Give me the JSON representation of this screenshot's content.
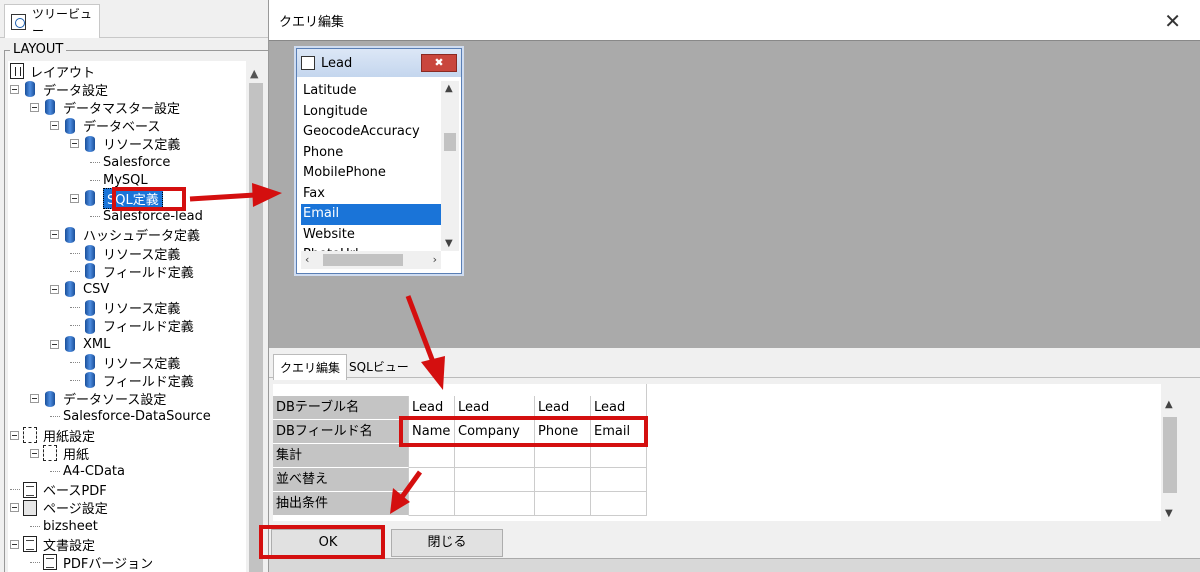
{
  "left_panel": {
    "tab_label": "ツリービュー",
    "frame_label": "LAYOUT",
    "tree": [
      {
        "label": "レイアウト",
        "icon": "layout-icon",
        "toggle": false
      },
      {
        "label": "データ設定",
        "icon": "database-icon",
        "toggle": true
      },
      {
        "label": "データマスター設定",
        "icon": "database-icon",
        "toggle": true
      },
      {
        "label": "データベース",
        "icon": "database-icon",
        "toggle": true
      },
      {
        "label": "リソース定義",
        "icon": "database-icon",
        "toggle": true
      },
      {
        "label": "Salesforce",
        "icon": "",
        "toggle": false
      },
      {
        "label": "MySQL",
        "icon": "",
        "toggle": false
      },
      {
        "label": "SQL定義",
        "icon": "database-icon",
        "toggle": true,
        "selected": true
      },
      {
        "label": "Salesforce-lead",
        "icon": "",
        "toggle": false
      },
      {
        "label": "ハッシュデータ定義",
        "icon": "database-icon",
        "toggle": true
      },
      {
        "label": "リソース定義",
        "icon": "database-icon",
        "toggle": false
      },
      {
        "label": "フィールド定義",
        "icon": "database-icon",
        "toggle": false
      },
      {
        "label": "CSV",
        "icon": "database-icon",
        "toggle": true
      },
      {
        "label": "リソース定義",
        "icon": "database-icon",
        "toggle": false
      },
      {
        "label": "フィールド定義",
        "icon": "database-icon",
        "toggle": false
      },
      {
        "label": "XML",
        "icon": "database-icon",
        "toggle": true
      },
      {
        "label": "リソース定義",
        "icon": "database-icon",
        "toggle": false
      },
      {
        "label": "フィールド定義",
        "icon": "database-icon",
        "toggle": false
      },
      {
        "label": "データソース設定",
        "icon": "database-icon",
        "toggle": true
      },
      {
        "label": "Salesforce-DataSource",
        "icon": "",
        "toggle": false
      },
      {
        "label": "用紙設定",
        "icon": "page-icon",
        "toggle": true
      },
      {
        "label": "用紙",
        "icon": "page-icon",
        "toggle": true
      },
      {
        "label": "A4-CData",
        "icon": "",
        "toggle": false
      },
      {
        "label": "ベースPDF",
        "icon": "document-icon",
        "toggle": false
      },
      {
        "label": "ページ設定",
        "icon": "page-settings-icon",
        "toggle": true
      },
      {
        "label": "bizsheet",
        "icon": "",
        "toggle": false
      },
      {
        "label": "文書設定",
        "icon": "document-icon",
        "toggle": true
      },
      {
        "label": "PDFバージョン",
        "icon": "document-icon",
        "toggle": false
      }
    ]
  },
  "dialog": {
    "title": "クエリ編集",
    "close_glyph": "✕",
    "table_window": {
      "title": "Lead",
      "close_glyph": "✖",
      "fields": [
        "Latitude",
        "Longitude",
        "GeocodeAccuracy",
        "Phone",
        "MobilePhone",
        "Fax",
        "Email",
        "Website",
        "PhotoUrl"
      ],
      "selected_field": "Email"
    },
    "tabs": [
      {
        "label": "クエリ編集",
        "active": true
      },
      {
        "label": "SQLビュー",
        "active": false
      }
    ],
    "grid": {
      "row_headers": [
        "DBテーブル名",
        "DBフィールド名",
        "集計",
        "並べ替え",
        "抽出条件"
      ],
      "columns": [
        {
          "table": "Lead",
          "field": "Name"
        },
        {
          "table": "Lead",
          "field": "Company"
        },
        {
          "table": "Lead",
          "field": "Phone"
        },
        {
          "table": "Lead",
          "field": "Email"
        }
      ]
    },
    "buttons": {
      "ok": "OK",
      "close": "閉じる"
    }
  },
  "annotation_color": "#d40f0f"
}
